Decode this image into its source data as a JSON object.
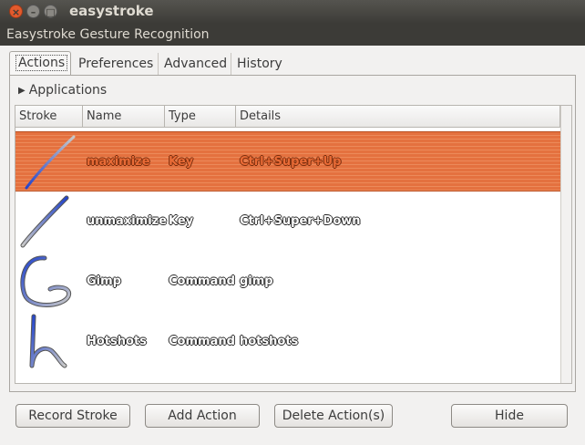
{
  "window": {
    "title": "easystroke",
    "subtitle": "Easystroke Gesture Recognition",
    "close_glyph": "×",
    "minimize_glyph": "–",
    "maximize_glyph": "□"
  },
  "tabs": [
    {
      "label": "Actions",
      "active": true
    },
    {
      "label": "Preferences",
      "active": false
    },
    {
      "label": "Advanced",
      "active": false
    },
    {
      "label": "History",
      "active": false
    }
  ],
  "expander": {
    "label": "Applications",
    "arrow": "▶",
    "icon": "triangle-right-icon"
  },
  "table": {
    "columns": [
      "Stroke",
      "Name",
      "Type",
      "Details"
    ],
    "rows": [
      {
        "stroke_icon": "diagonal-up-stroke-icon",
        "name": "maximize",
        "type": "Key",
        "details": "Ctrl+Super+Up",
        "selected": true
      },
      {
        "stroke_icon": "diagonal-down-stroke-icon",
        "name": "unmaximize",
        "type": "Key",
        "details": "Ctrl+Super+Down",
        "selected": false
      },
      {
        "stroke_icon": "g-shape-stroke-icon",
        "name": "Gimp",
        "type": "Command",
        "details": "gimp",
        "selected": false
      },
      {
        "stroke_icon": "h-shape-stroke-icon",
        "name": "Hotshots",
        "type": "Command",
        "details": "hotshots",
        "selected": false
      }
    ]
  },
  "buttons": {
    "record": "Record Stroke",
    "add": "Add Action",
    "delete": "Delete Action(s)",
    "hide": "Hide"
  },
  "colors": {
    "selection": "#e4713f",
    "titlebar": "#3c3b37",
    "close_button": "#e35a2c",
    "stroke_start": "#2244cc",
    "stroke_end": "#c8c8c8"
  }
}
